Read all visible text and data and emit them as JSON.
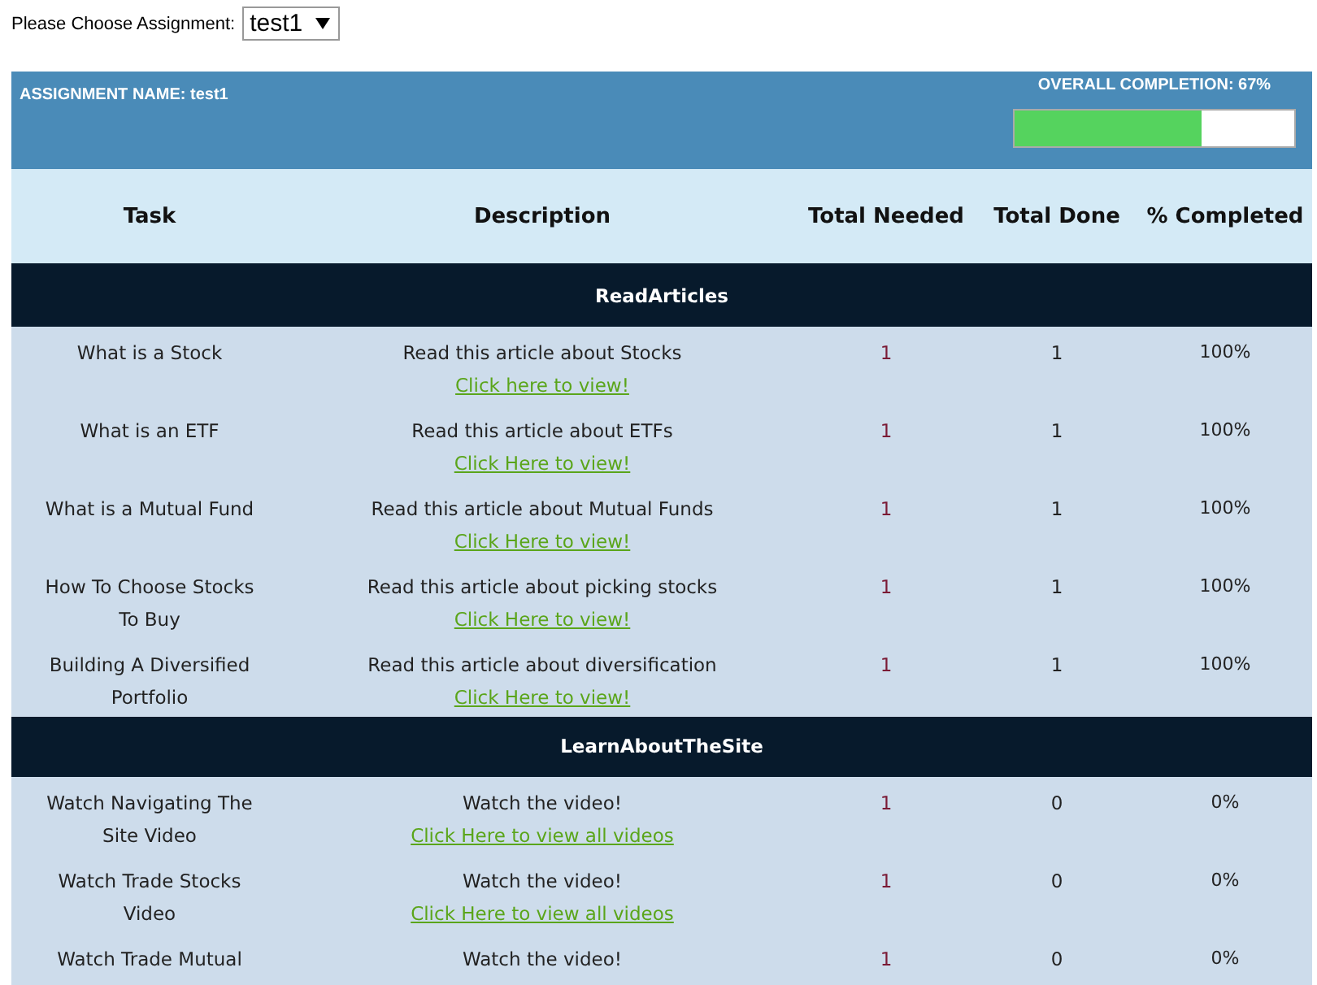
{
  "assignment_picker": {
    "label": "Please Choose Assignment:",
    "value": "test1"
  },
  "summary": {
    "assignment_name": "ASSIGNMENT NAME: test1",
    "completion_label": "OVERALL COMPLETION: 67%",
    "level": 0.67
  },
  "table": {
    "columns": [
      "Task",
      "Description",
      "Total Needed",
      "Total Done",
      "% Completed"
    ],
    "sections": [
      {
        "title": "ReadArticles",
        "rows": [
          {
            "task": "What is a Stock",
            "description": "Read this article about Stocks",
            "link": "Click here to view!",
            "needed": "1",
            "done": "1",
            "percent": "100%"
          },
          {
            "task": "What is an ETF",
            "description": "Read this article about ETFs",
            "link": "Click Here to view!",
            "needed": "1",
            "done": "1",
            "percent": "100%"
          },
          {
            "task": "What is a Mutual Fund",
            "description": "Read this article about Mutual Funds",
            "link": "Click Here to view!",
            "needed": "1",
            "done": "1",
            "percent": "100%"
          },
          {
            "task": "How To Choose Stocks To Buy",
            "description": "Read this article about picking stocks",
            "link": "Click Here to view!",
            "needed": "1",
            "done": "1",
            "percent": "100%"
          },
          {
            "task": "Building A Diversified Portfolio",
            "description": "Read this article about diversification",
            "link": "Click Here to view!",
            "needed": "1",
            "done": "1",
            "percent": "100%"
          }
        ]
      },
      {
        "title": "LearnAboutTheSite",
        "rows": [
          {
            "task": "Watch Navigating The Site Video",
            "description": "Watch the video!",
            "link": "Click Here to view all videos",
            "needed": "1",
            "done": "0",
            "percent": "0%"
          },
          {
            "task": "Watch Trade Stocks Video",
            "description": "Watch the video!",
            "link": "Click Here to view all videos",
            "needed": "1",
            "done": "0",
            "percent": "0%"
          },
          {
            "task": "Watch Trade Mutual",
            "description": "Watch the video!",
            "needed": "1",
            "done": "0",
            "percent": "0%"
          }
        ]
      }
    ]
  }
}
